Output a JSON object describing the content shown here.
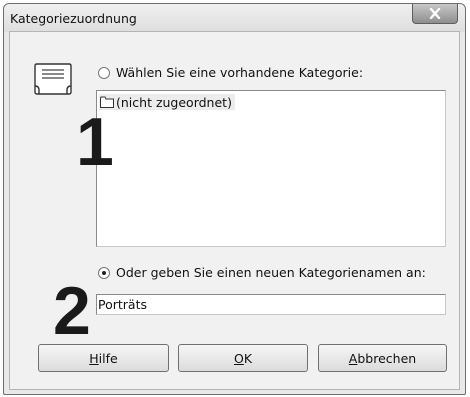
{
  "window": {
    "title": "Kategoriezuordnung"
  },
  "options": {
    "existing_label": "Wählen Sie eine vorhandene Kategorie:",
    "existing_selected": false,
    "new_label": "Oder geben Sie einen neuen Kategorienamen an:",
    "new_selected": true
  },
  "category_list": {
    "items": [
      {
        "label": "(nicht zugeordnet)",
        "icon": "folder-icon"
      }
    ]
  },
  "new_category": {
    "value": "Porträts"
  },
  "annotations": {
    "step1": "1",
    "step2": "2"
  },
  "buttons": {
    "help": {
      "mnemonic": "H",
      "rest": "ilfe"
    },
    "ok": {
      "mnemonic": "O",
      "rest": "K"
    },
    "cancel": {
      "mnemonic": "A",
      "rest": "bbrechen"
    }
  },
  "icons": {
    "close": "close-icon",
    "category": "category-card-icon"
  },
  "colors": {
    "dialog_background": "#f1f1f1",
    "frame": "#e9e9e9",
    "close_button": "#a0a0a0"
  }
}
